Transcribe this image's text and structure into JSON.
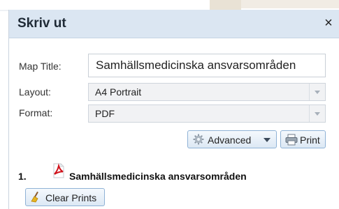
{
  "dialog": {
    "title": "Skriv ut",
    "close_glyph": "×"
  },
  "form": {
    "map_title_label": "Map Title:",
    "map_title_value": "Samhällsmedicinska ansvarsområden",
    "layout_label": "Layout:",
    "layout_value": "A4 Portrait",
    "format_label": "Format:",
    "format_value": "PDF"
  },
  "buttons": {
    "advanced_label": "Advanced",
    "print_label": "Print",
    "clear_prints_label": "Clear Prints"
  },
  "results": [
    {
      "number": "1.",
      "icon": "pdf-icon",
      "title": "Samhällsmedicinska ansvarsområden"
    }
  ]
}
